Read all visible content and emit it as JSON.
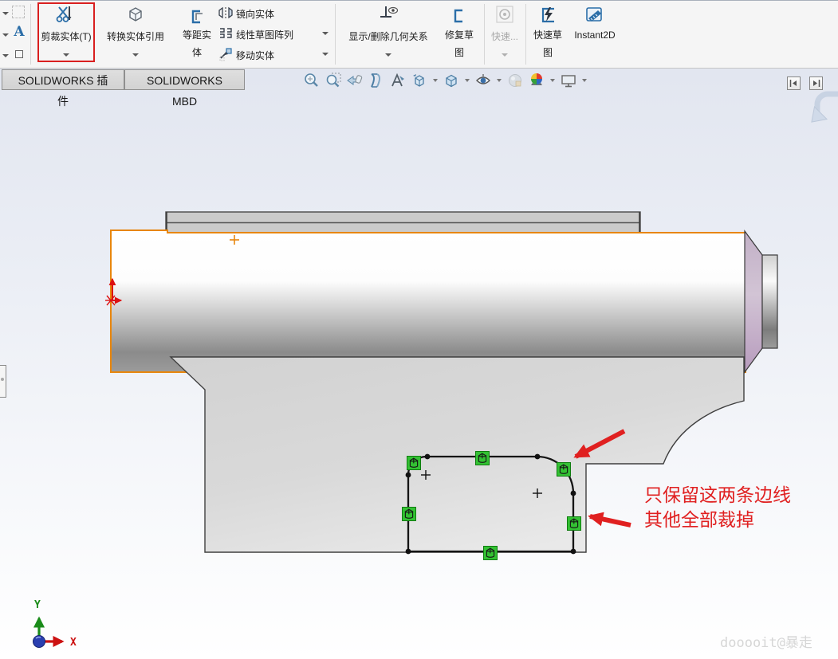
{
  "colors": {
    "accent_orange": "#e8860d",
    "relation_green": "#33c133",
    "annotation_red": "#e02020",
    "toolbar_blue": "#2b6ea8"
  },
  "toolbar": {
    "text_tool_glyph": "A",
    "trim": {
      "label": "剪裁实体(T)"
    },
    "convert": {
      "label": "转换实体引用"
    },
    "offset": {
      "line1": "等距实",
      "line2": "体"
    },
    "mirror": {
      "label": "镜向实体"
    },
    "linear_pattern": {
      "label": "线性草图阵列"
    },
    "move": {
      "label": "移动实体"
    },
    "relations": {
      "label": "显示/删除几何关系"
    },
    "repair": {
      "line1": "修复草",
      "line2": "图"
    },
    "quick_snaps": {
      "label": "快速..."
    },
    "rapid_sketch": {
      "line1": "快速草",
      "line2": "图"
    },
    "instant2d": {
      "label": "Instant2D"
    }
  },
  "tabs": {
    "addins": "SOLIDWORKS 插件",
    "mbd": "SOLIDWORKS MBD"
  },
  "heads_up_icons": [
    "zoom-to-fit",
    "zoom-to-area",
    "previous-view",
    "section-view",
    "dynamic-annotation",
    "view-orientation",
    "display-style",
    "hide-show-items",
    "edit-appearance",
    "apply-scene",
    "view-settings"
  ],
  "annotation": {
    "line1": "只保留这两条边线",
    "line2": "其他全部裁掉"
  },
  "triad": {
    "x": "X",
    "y": "Y"
  },
  "watermark": "dooooit@暴走"
}
